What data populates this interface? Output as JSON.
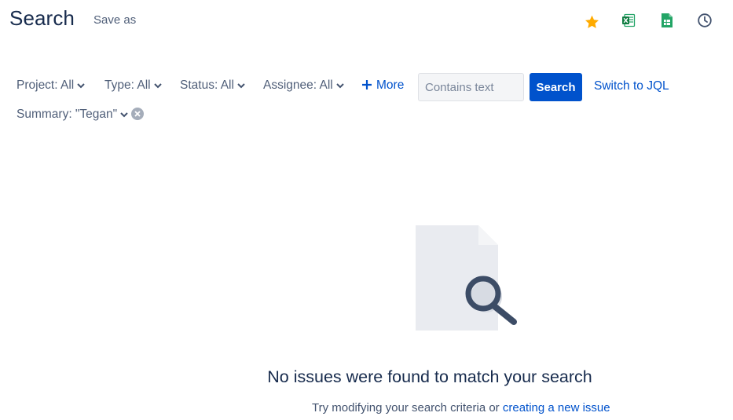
{
  "header": {
    "title": "Search",
    "save_as_label": "Save as",
    "icons": [
      "star-icon",
      "excel-export-icon",
      "sheets-export-icon",
      "clock-icon"
    ],
    "star_color": "#FFAB00"
  },
  "filters": {
    "project": "Project: All",
    "type": "Type: All",
    "status": "Status: All",
    "assignee": "Assignee: All",
    "more": "More",
    "summary": "Summary: \"Tegan\""
  },
  "search": {
    "placeholder": "Contains text",
    "value": "",
    "button_label": "Search",
    "switch_label": "Switch to JQL"
  },
  "empty_state": {
    "title": "No issues were found to match your search",
    "hint_text": "Try modifying your search criteria or ",
    "hint_link": "creating a new issue"
  },
  "colors": {
    "accent": "#0052CC",
    "text": "#172B4D"
  }
}
